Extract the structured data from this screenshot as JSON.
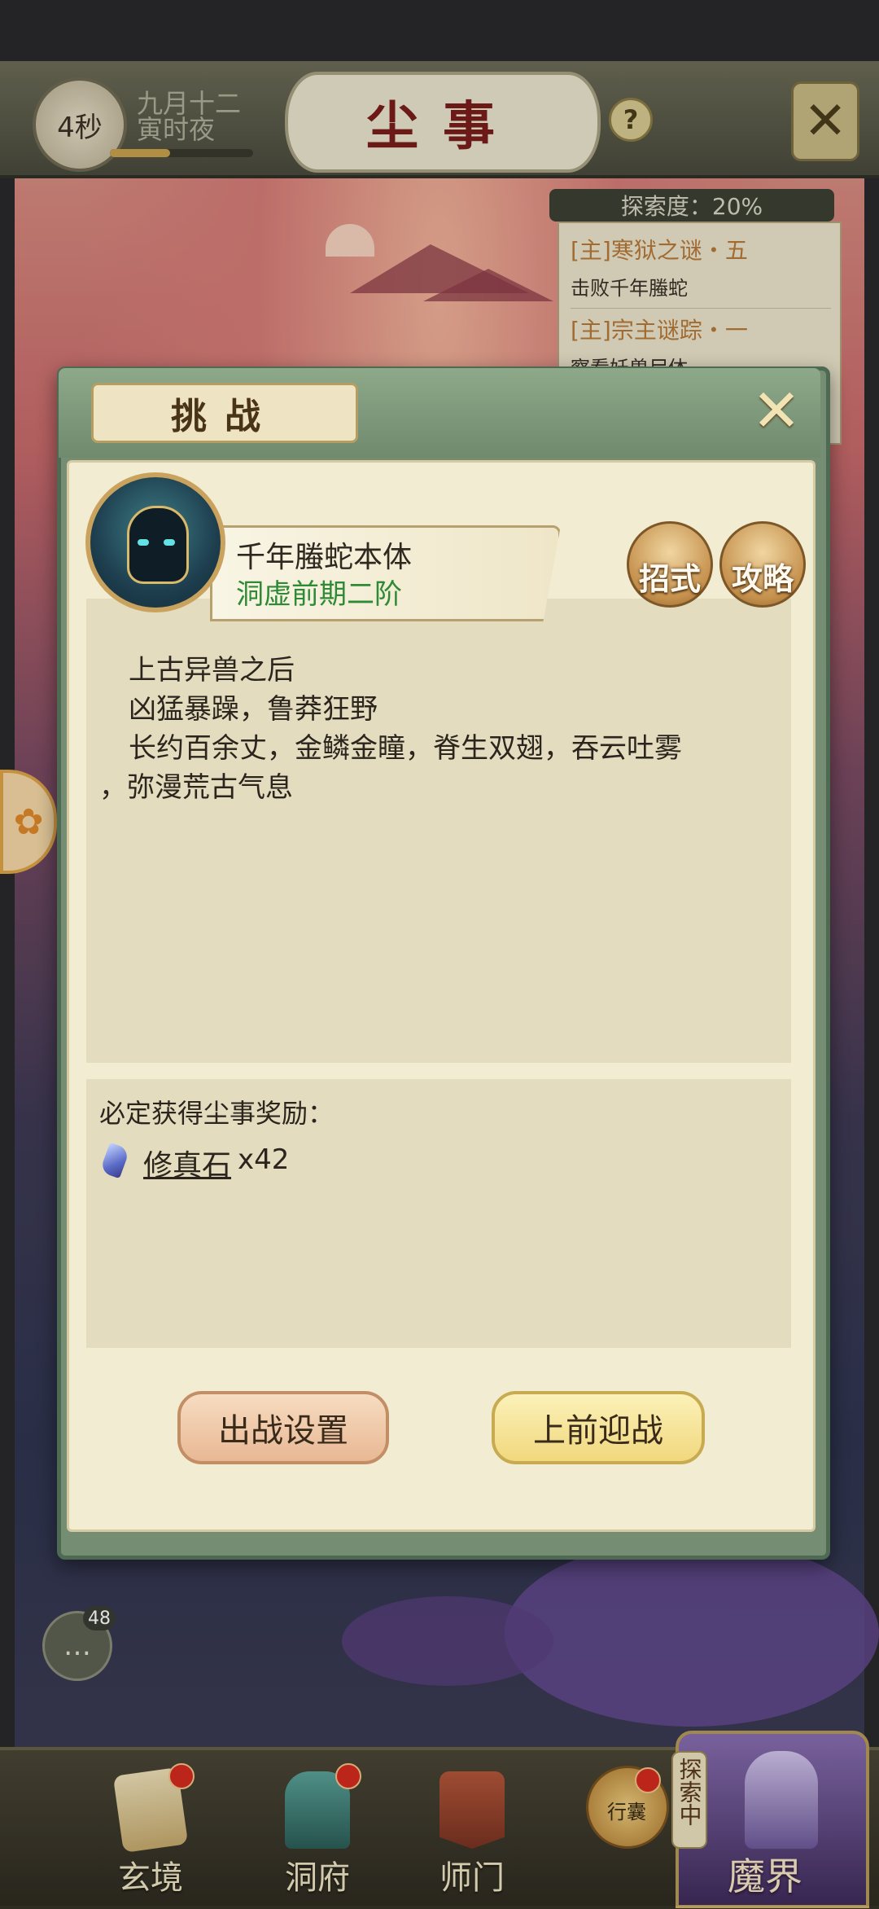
{
  "header": {
    "timer": "4秒",
    "date_line1": "九月十二",
    "date_line2": "寅时夜",
    "day_progress": 0.42,
    "title": "尘事",
    "help_icon": "question-icon",
    "close_icon": "close-icon"
  },
  "explore": {
    "label": "探索度：20%",
    "quests": [
      {
        "title": "[主]寒狱之谜・五",
        "desc": "击败千年螣蛇"
      },
      {
        "title": "[主]宗主谜踪・一",
        "desc": "察看妖兽尸体"
      }
    ]
  },
  "chat": {
    "count": "48",
    "icon": "chat-icon"
  },
  "dialog": {
    "title": "挑战",
    "close_icon": "close-icon",
    "boss": {
      "name": "千年螣蛇本体",
      "realm": "洞虚前期二阶"
    },
    "buttons": {
      "moves": "招式",
      "guide": "攻略",
      "setup": "出战设置",
      "fight": "上前迎战"
    },
    "description": [
      "上古异兽之后",
      "凶猛暴躁，鲁莽狂野",
      "长约百余丈，金鳞金瞳，脊生双翅，吞云吐雾",
      "，弥漫荒古气息"
    ],
    "reward": {
      "title": "必定获得尘事奖励：",
      "item_name": "修真石",
      "item_qty": "x42",
      "item_icon": "gem-icon"
    }
  },
  "nav": {
    "items": [
      {
        "label": "玄境",
        "icon": "scroll-icon"
      },
      {
        "label": "洞府",
        "icon": "pavilion-icon"
      },
      {
        "label": "师门",
        "icon": "banner-icon"
      },
      {
        "label": "行囊",
        "icon": "bag-icon"
      }
    ],
    "realm_badge": "探索中",
    "realm_label": "魔界"
  },
  "colors": {
    "accent_green": "#2e8a35",
    "title_red": "#7a1e1c",
    "dialog_frame": "#758d73"
  }
}
